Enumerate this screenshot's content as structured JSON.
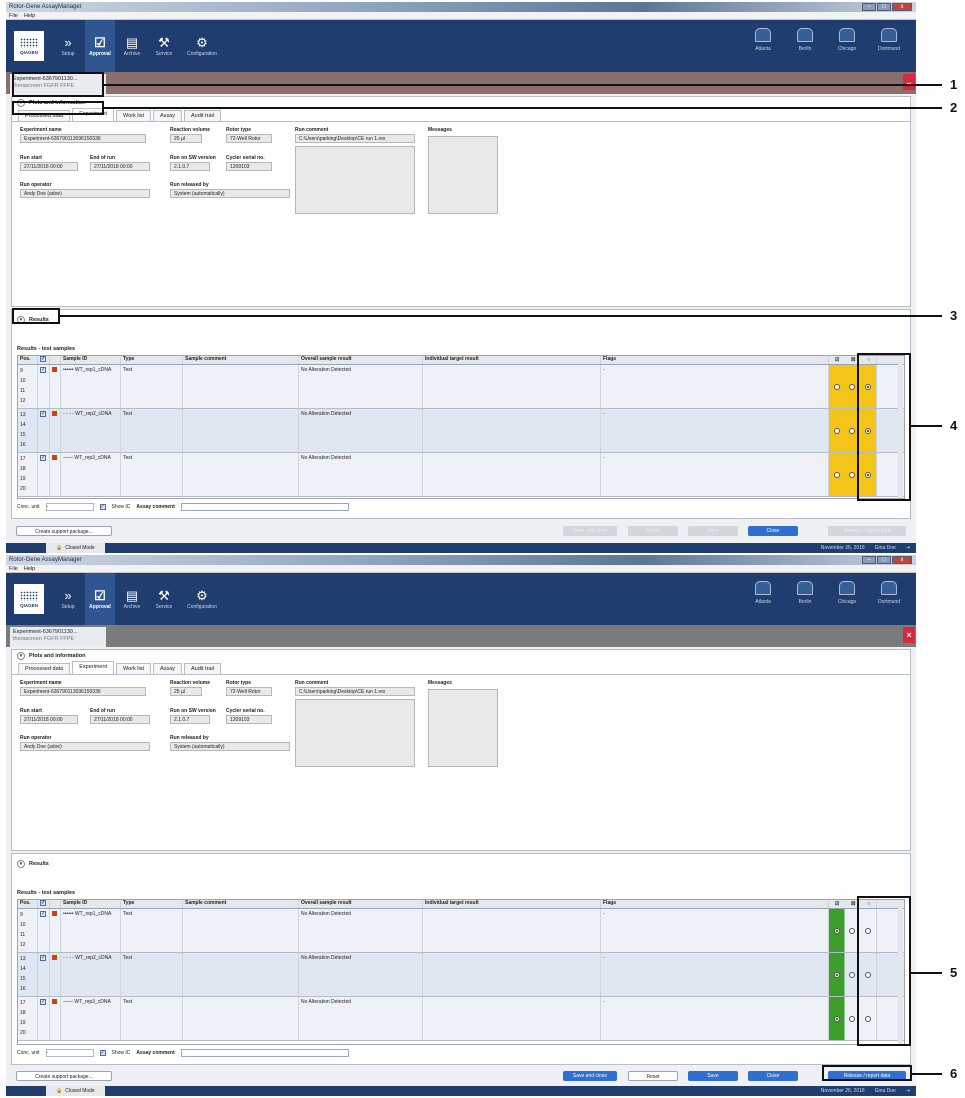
{
  "window": {
    "title": "Rotor-Gene AssayManager",
    "menu": [
      "File",
      "Help"
    ]
  },
  "nav": [
    {
      "label": "Setup",
      "icon": "setup-icon",
      "glyph": "»"
    },
    {
      "label": "Approval",
      "icon": "approval-icon",
      "glyph": "☑"
    },
    {
      "label": "Archive",
      "icon": "archive-icon",
      "glyph": "▤"
    },
    {
      "label": "Service",
      "icon": "service-icon",
      "glyph": "⚒"
    },
    {
      "label": "Configuration",
      "icon": "configuration-icon",
      "glyph": "⚙"
    }
  ],
  "logo_text": "QIAGEN",
  "cyclers": [
    "Atlanta",
    "Berlin",
    "Chicago",
    "Dortmund"
  ],
  "experiment_tab": {
    "title": "Experiment-6367901130...",
    "subtitle": "therascreen FGFR FFPE"
  },
  "plots_section": "Plots and information",
  "tabs": [
    "Processed data",
    "Experiment",
    "Work list",
    "Assay",
    "Audit trail"
  ],
  "fields": {
    "experiment_name_label": "Experiment name",
    "experiment_name": "Experiment-636790113036150336",
    "reaction_volume_label": "Reaction volume",
    "reaction_volume": "25 µl",
    "rotor_type_label": "Rotor type",
    "rotor_type": "72-Well Rotor",
    "run_comment_label": "Run comment",
    "run_comment": "C:\\Users\\parking\\Desktop\\CE run 1.rex",
    "messages_label": "Messages",
    "run_start_label": "Run start",
    "run_start": "27/11/2018 00:00",
    "end_of_run_label": "End of run",
    "end_of_run": "27/11/2018 00:00",
    "sw_version_label": "Run on SW version",
    "sw_version": "2.1.0.7",
    "cycler_serial_label": "Cycler serial no.",
    "cycler_serial": "1209103",
    "run_operator_label": "Run operator",
    "run_operator": "Andy Doe (adoe)",
    "released_by_label": "Run released by",
    "released_by": "System (automatically)"
  },
  "results_section": "Results",
  "results_title": "Results - test samples",
  "columns": [
    "Pos.",
    "",
    "Style",
    "Sample ID",
    "Type",
    "Sample comment",
    "Overall sample result",
    "Individual target result",
    "Flags"
  ],
  "rows": [
    {
      "pos": [
        "9",
        "10",
        "11",
        "12"
      ],
      "style": "••••••",
      "sample_id": "WT_rep1_cDNA",
      "type": "Test",
      "overall": "No Alteration Detected",
      "flags": "-"
    },
    {
      "pos": [
        "13",
        "14",
        "15",
        "16"
      ],
      "style": "- - - -",
      "sample_id": "WT_rep2_cDNA",
      "type": "Test",
      "overall": "No Alteration Detected",
      "flags": "-"
    },
    {
      "pos": [
        "17",
        "18",
        "19",
        "20"
      ],
      "style": "——",
      "sample_id": "WT_rep3_cDNA",
      "type": "Test",
      "overall": "No Alteration Detected",
      "flags": "-"
    }
  ],
  "bottom": {
    "conc_unit_label": "Conc. unit",
    "conc_unit_value": "-",
    "show_ic": "Show IC",
    "assay_comment_label": "Assay comment"
  },
  "buttons": {
    "create_support": "Create support package...",
    "save_and_close": "Save and close",
    "reset": "Reset",
    "save": "Save",
    "close": "Close",
    "release": "Release / report data"
  },
  "status": {
    "mode": "Closed Mode",
    "date": "November 26, 2018",
    "user": "Gina Doe"
  },
  "callouts": [
    "1",
    "2",
    "3",
    "4",
    "5",
    "6"
  ],
  "colors": {
    "accepted": "#f4c419",
    "released": "#3d9e2e",
    "toolbar": "#1f3d6e",
    "close": "#d7283d"
  }
}
